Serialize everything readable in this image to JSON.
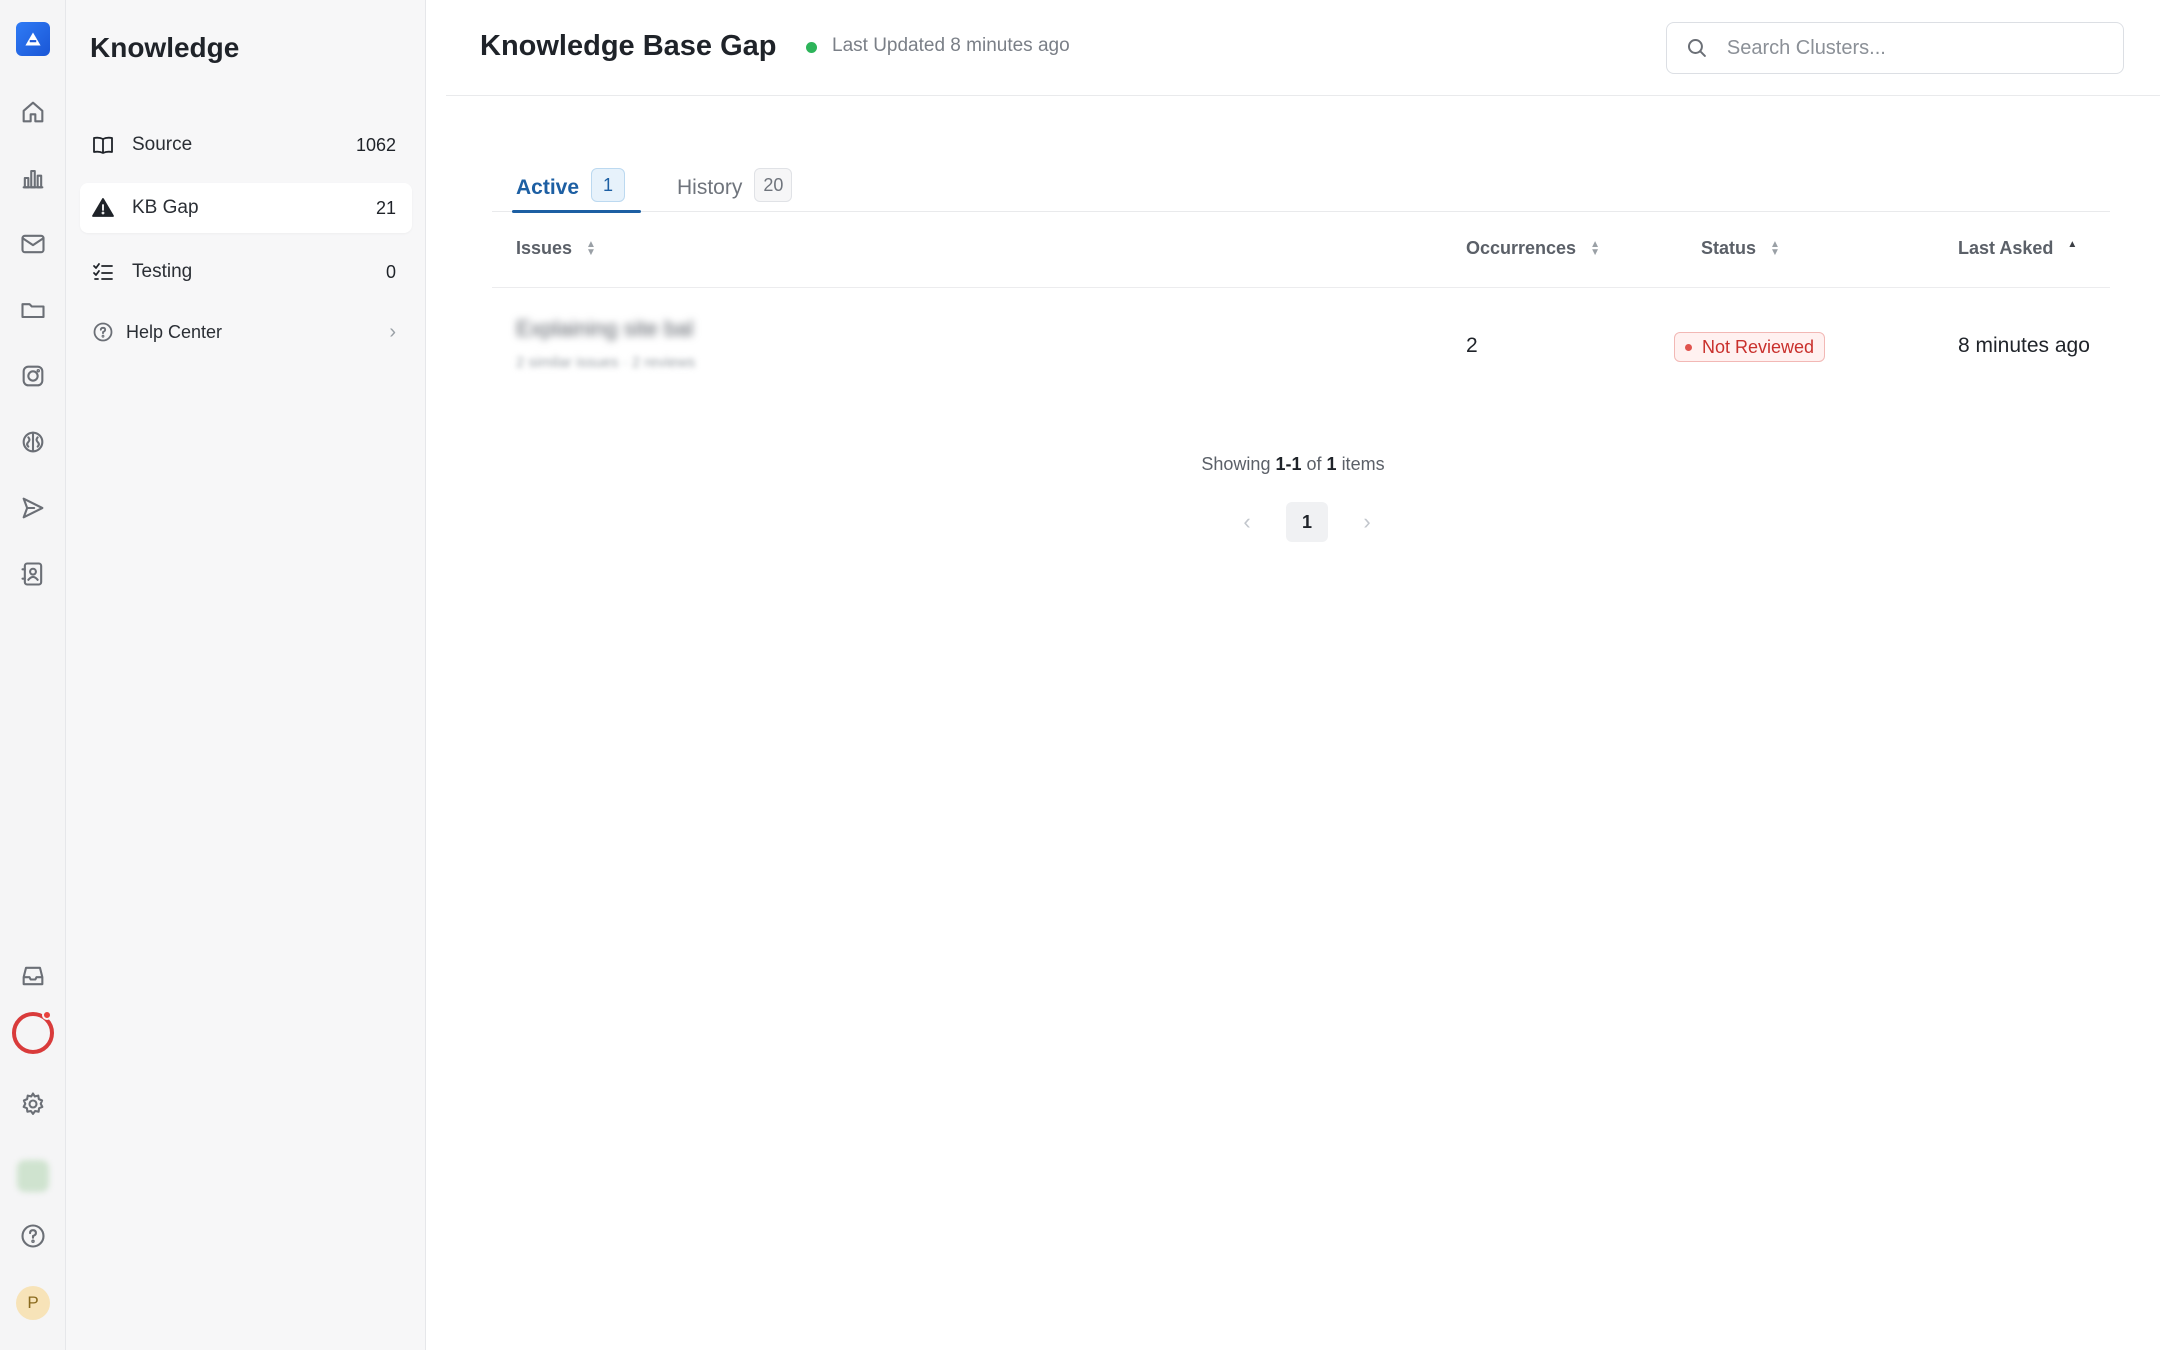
{
  "rail": {
    "icons": [
      "home-icon",
      "chart-icon",
      "mail-icon",
      "folder-icon",
      "instagram-icon",
      "brain-icon",
      "send-icon",
      "contacts-icon",
      "inbox-icon",
      "settings-icon",
      "help-icon"
    ],
    "user_initial": "P",
    "accent": "#2f7bf5",
    "notification_color": "#e8413c"
  },
  "sidebar": {
    "title": "Knowledge",
    "items": [
      {
        "label": "Source",
        "count": "1062",
        "icon": "book-icon"
      },
      {
        "label": "KB Gap",
        "count": "21",
        "icon": "warning-icon"
      },
      {
        "label": "Testing",
        "count": "0",
        "icon": "checklist-icon"
      },
      {
        "label": "Help Center",
        "icon": "help-circle-icon"
      }
    ]
  },
  "header": {
    "title": "Knowledge Base Gap",
    "updated": "Last Updated 8 minutes ago",
    "status_color": "#2db45a",
    "search_placeholder": "Search Clusters..."
  },
  "tabs": [
    {
      "label": "Active",
      "count": "1"
    },
    {
      "label": "History",
      "count": "20"
    }
  ],
  "table": {
    "columns": [
      "Issues",
      "Occurrences",
      "Status",
      "Last Asked"
    ],
    "rows": [
      {
        "issue": "Explaining site bal",
        "issue_sub": "2 similar issues · 2 reviews",
        "occurrences": "2",
        "status": "Not Reviewed",
        "last_asked": "8 minutes ago"
      }
    ]
  },
  "pagination": {
    "prefix": "Showing",
    "range": "1-1",
    "of": "of",
    "total": "1",
    "suffix": "items",
    "current_page": "1"
  }
}
